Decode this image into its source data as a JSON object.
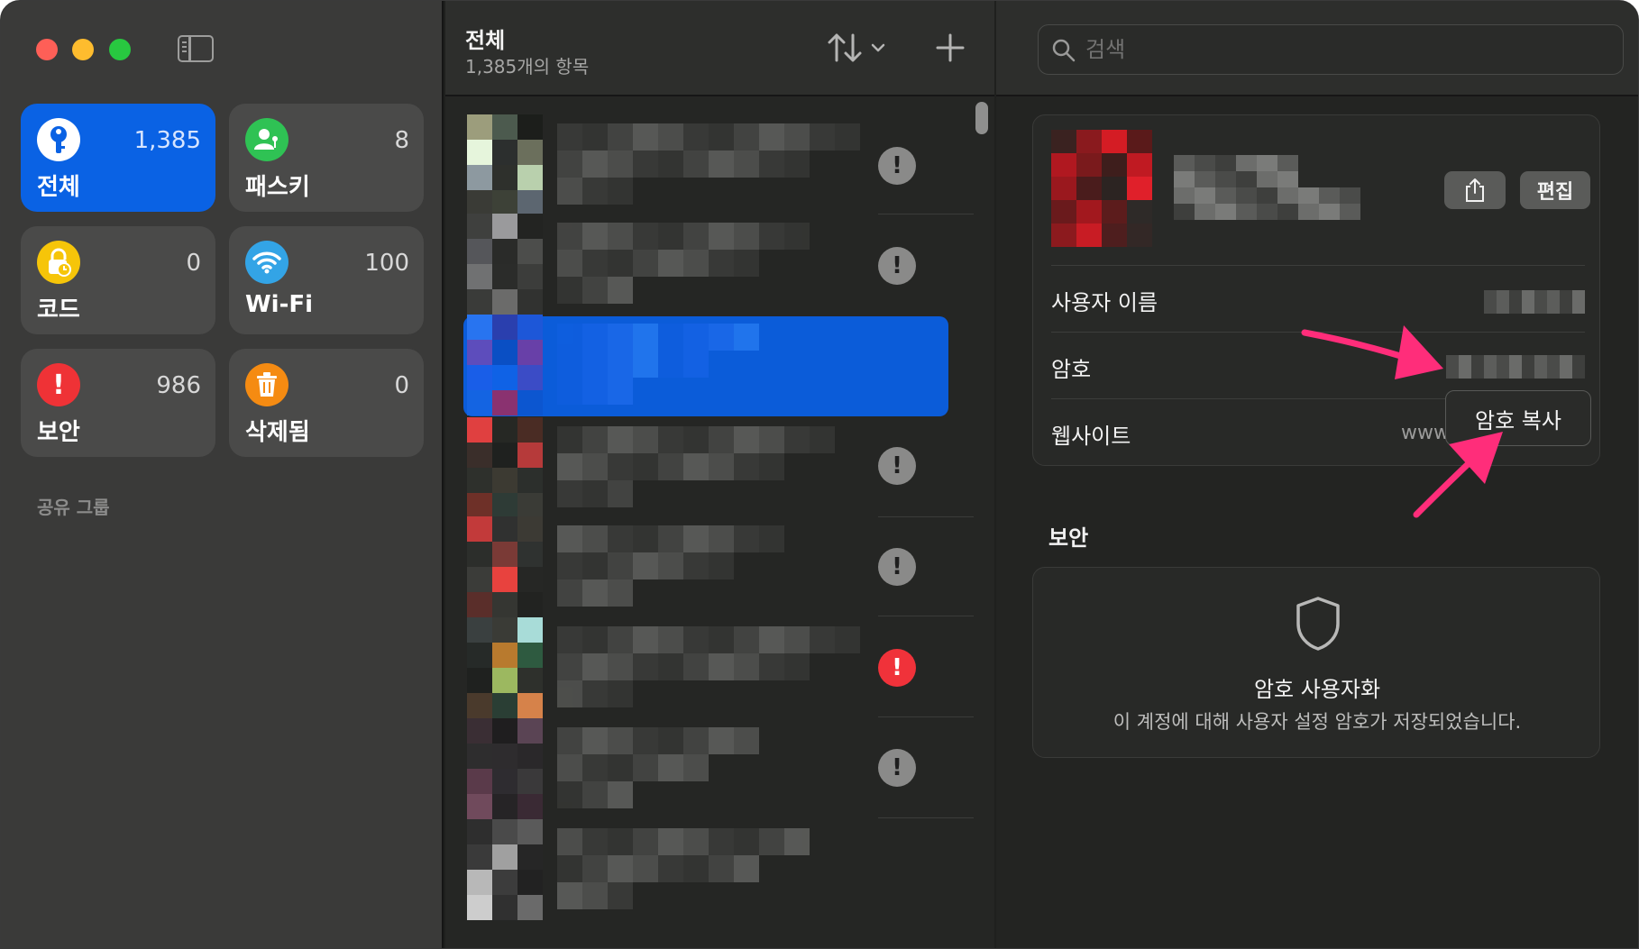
{
  "window": {
    "traffic_lights": [
      "close",
      "minimize",
      "zoom"
    ]
  },
  "sidebar": {
    "tiles": [
      {
        "label": "전체",
        "count": "1,385",
        "icon": "key-icon",
        "color": "#0a62e4",
        "active": true
      },
      {
        "label": "패스키",
        "count": "8",
        "icon": "passkey-person-icon",
        "color": "#2fc254"
      },
      {
        "label": "코드",
        "count": "0",
        "icon": "lock-clock-icon",
        "color": "#f6c509"
      },
      {
        "label": "Wi-Fi",
        "count": "100",
        "icon": "wifi-icon",
        "color": "#33a4e6"
      },
      {
        "label": "보안",
        "count": "986",
        "icon": "exclamation-icon",
        "color": "#ef3236"
      },
      {
        "label": "삭제됨",
        "count": "0",
        "icon": "trash-icon",
        "color": "#f58b12"
      }
    ],
    "shared_groups_title": "공유 그룹"
  },
  "list": {
    "title": "전체",
    "subtitle": "1,385개의 항목",
    "rows": [
      {
        "warning": "gray"
      },
      {
        "warning": "gray"
      },
      {
        "warning": "none",
        "selected": true
      },
      {
        "warning": "gray"
      },
      {
        "warning": "gray"
      },
      {
        "warning": "red"
      },
      {
        "warning": "gray"
      },
      {
        "warning": "none"
      }
    ]
  },
  "detail": {
    "search_placeholder": "검색",
    "edit_label": "편집",
    "fields": {
      "username_label": "사용자 이름",
      "password_label": "암호",
      "website_label": "웹사이트",
      "website_value": "www"
    },
    "copy_password_popup": "암호 복사",
    "security_section_title": "보안",
    "security_card": {
      "title": "암호 사용자화",
      "description": "이 계정에 대해 사용자 설정 암호가 저장되었습니다."
    }
  },
  "annotations": {
    "arrow_color": "#ff2d7a"
  }
}
